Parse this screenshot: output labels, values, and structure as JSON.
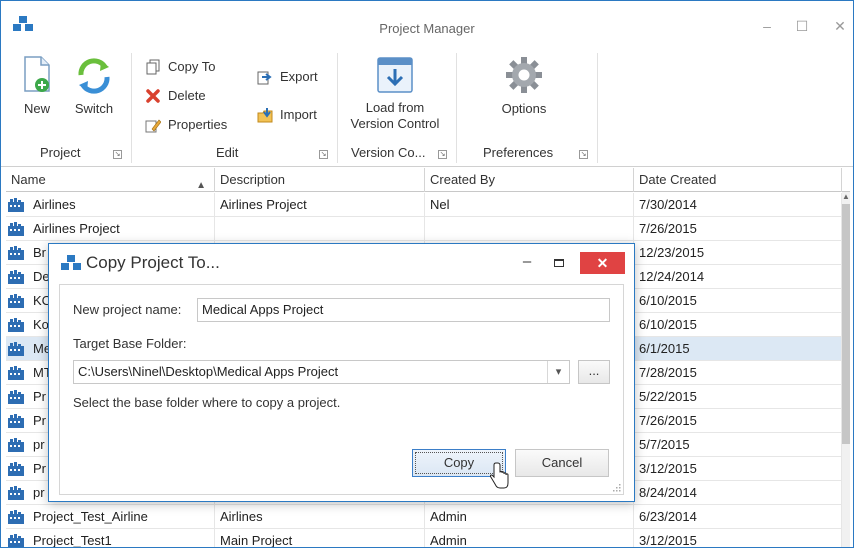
{
  "window": {
    "title": "Project Manager"
  },
  "ribbon": {
    "project": {
      "new_label": "New",
      "switch_label": "Switch",
      "group_label": "Project"
    },
    "edit": {
      "copy_to_label": "Copy To",
      "delete_label": "Delete",
      "properties_label": "Properties",
      "export_label": "Export",
      "import_label": "Import",
      "group_label": "Edit"
    },
    "version_control": {
      "load_label_line1": "Load from",
      "load_label_line2": "Version Control",
      "group_label": "Version Co..."
    },
    "preferences": {
      "options_label": "Options",
      "group_label": "Preferences"
    }
  },
  "grid": {
    "columns": {
      "name": "Name",
      "description": "Description",
      "created_by": "Created By",
      "date_created": "Date Created"
    },
    "rows": [
      {
        "name": "Airlines",
        "description": "Airlines Project",
        "created_by": "Nel",
        "date": "7/30/2014"
      },
      {
        "name": "Airlines Project",
        "description": "",
        "created_by": "",
        "date": "7/26/2015"
      },
      {
        "name": "Br",
        "description": "",
        "created_by": "",
        "date": "12/23/2015"
      },
      {
        "name": "De",
        "description": "",
        "created_by": "",
        "date": "12/24/2014"
      },
      {
        "name": "KC",
        "description": "",
        "created_by": "",
        "date": "6/10/2015"
      },
      {
        "name": "Ko",
        "description": "",
        "created_by": "",
        "date": "6/10/2015"
      },
      {
        "name": "Me",
        "description": "",
        "created_by": "",
        "date": "6/1/2015"
      },
      {
        "name": "MT",
        "description": "",
        "created_by": "",
        "date": "7/28/2015"
      },
      {
        "name": "Pr",
        "description": "",
        "created_by": "",
        "date": "5/22/2015"
      },
      {
        "name": "Pr",
        "description": "",
        "created_by": "",
        "date": "7/26/2015"
      },
      {
        "name": "pr",
        "description": "",
        "created_by": "",
        "date": "5/7/2015"
      },
      {
        "name": "Pr",
        "description": "",
        "created_by": "",
        "date": "3/12/2015"
      },
      {
        "name": "pr",
        "description": "",
        "created_by": "",
        "date": "8/24/2014"
      },
      {
        "name": "Project_Test_Airline",
        "description": "Airlines",
        "created_by": "Admin",
        "date": "6/23/2014"
      },
      {
        "name": "Project_Test1",
        "description": "Main Project",
        "created_by": "Admin",
        "date": "3/12/2015"
      }
    ]
  },
  "dialog": {
    "title": "Copy Project To...",
    "close_glyph": "✕",
    "min_glyph": "–",
    "project_name_label": "New project name:",
    "project_name_value": "Medical Apps Project",
    "target_folder_label": "Target Base Folder:",
    "target_folder_value": "C:\\Users\\Ninel\\Desktop\\Medical Apps Project",
    "browse_label": "...",
    "hint": "Select the base folder where to copy a project.",
    "copy_label": "Copy",
    "cancel_label": "Cancel"
  },
  "colors": {
    "accent": "#2b79c2",
    "close_red": "#e04343",
    "selected_row": "#dce8f4"
  }
}
